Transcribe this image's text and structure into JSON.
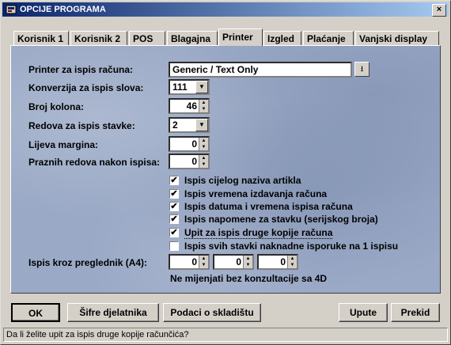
{
  "window": {
    "title": "OPCIJE PROGRAMA",
    "close_glyph": "×"
  },
  "tabs": [
    {
      "label": "Korisnik 1"
    },
    {
      "label": "Korisnik 2"
    },
    {
      "label": "POS"
    },
    {
      "label": "Blagajna"
    },
    {
      "label": "Printer",
      "active": true
    },
    {
      "label": "Izgled"
    },
    {
      "label": "Plaćanje"
    },
    {
      "label": "Vanjski display"
    }
  ],
  "fields": {
    "printer_label": "Printer za ispis računa:",
    "printer_value": "Generic / Text Only",
    "conversion_label": "Konverzija za ispis slova:",
    "conversion_value": "111",
    "columns_label": "Broj kolona:",
    "columns_value": "46",
    "rows_label": "Redova za ispis stavke:",
    "rows_value": "2",
    "margin_label": "Lijeva margina:",
    "margin_value": "0",
    "empty_rows_label": "Praznih redova nakon ispisa:",
    "empty_rows_value": "0"
  },
  "checkboxes": [
    {
      "label": "Ispis cijelog naziva artikla",
      "checked": true
    },
    {
      "label": "Ispis vremena izdavanja računa",
      "checked": true
    },
    {
      "label": "Ispis datuma i vremena ispisa računa",
      "checked": true
    },
    {
      "label": "Ispis napomene za stavku (serijskog broja)",
      "checked": true
    },
    {
      "label": "Upit za ispis druge kopije računa",
      "checked": true
    },
    {
      "label": "Ispis svih stavki naknadne isporuke na 1 ispisu",
      "checked": false
    }
  ],
  "preview": {
    "label": "Ispis kroz preglednik (A4):",
    "values": [
      "0",
      "0",
      "0"
    ],
    "note": "Ne mijenjati bez konzultacije sa 4D"
  },
  "buttons": {
    "ok": "OK",
    "sifre": "Šifre djelatnika",
    "podaci": "Podaci o skladištu",
    "upute": "Upute",
    "prekid": "Prekid"
  },
  "status_text": "Da li želite upit za ispis druge kopije računčića?",
  "colors": {
    "titlebar_start": "#0a246a",
    "titlebar_end": "#a6caf0",
    "panel_bg": "#9aa9c6",
    "face": "#d4d0c8"
  }
}
